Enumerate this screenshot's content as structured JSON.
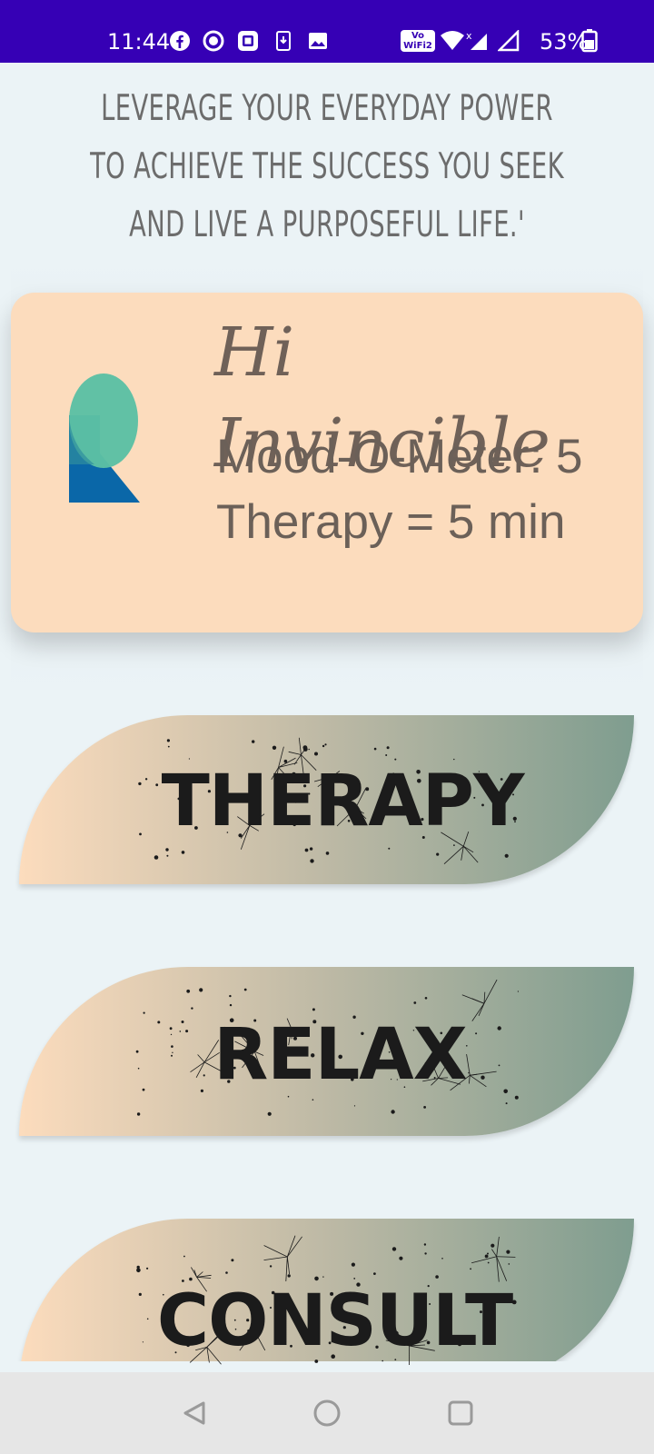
{
  "status_bar": {
    "time": "11:44",
    "battery": "53%",
    "volte_line1": "Vo",
    "volte_line2": "WiFi2",
    "icons": [
      "facebook-icon",
      "circle-status-icon",
      "message-app-icon",
      "download-icon",
      "image-icon",
      "wifi-icon",
      "signal-icon",
      "battery-icon"
    ]
  },
  "quote": "LEVERAGE YOUR EVERYDAY POWER TO ACHIEVE THE SUCCESS YOU SEEK AND LIVE A PURPOSEFUL LIFE.'",
  "card": {
    "greeting": "Hi Invincible",
    "mood": "Mood-O-Meter: 5",
    "therapy": "Therapy = 5 min"
  },
  "buttons": {
    "therapy": "THERAPY",
    "relax": "RELAX",
    "consult": "CONSULT"
  },
  "colors": {
    "status_bar": "#3600b5",
    "background": "#ebf3f6",
    "card": "#fcdcbd",
    "gradient_start": "#fcdcbd",
    "gradient_end": "#7f9d8f",
    "logo_teal": "#5cc0a4",
    "logo_blue": "#0a67a8"
  },
  "nav_bar": {
    "icons": [
      "back-triangle-icon",
      "home-circle-icon",
      "recents-square-icon"
    ]
  }
}
